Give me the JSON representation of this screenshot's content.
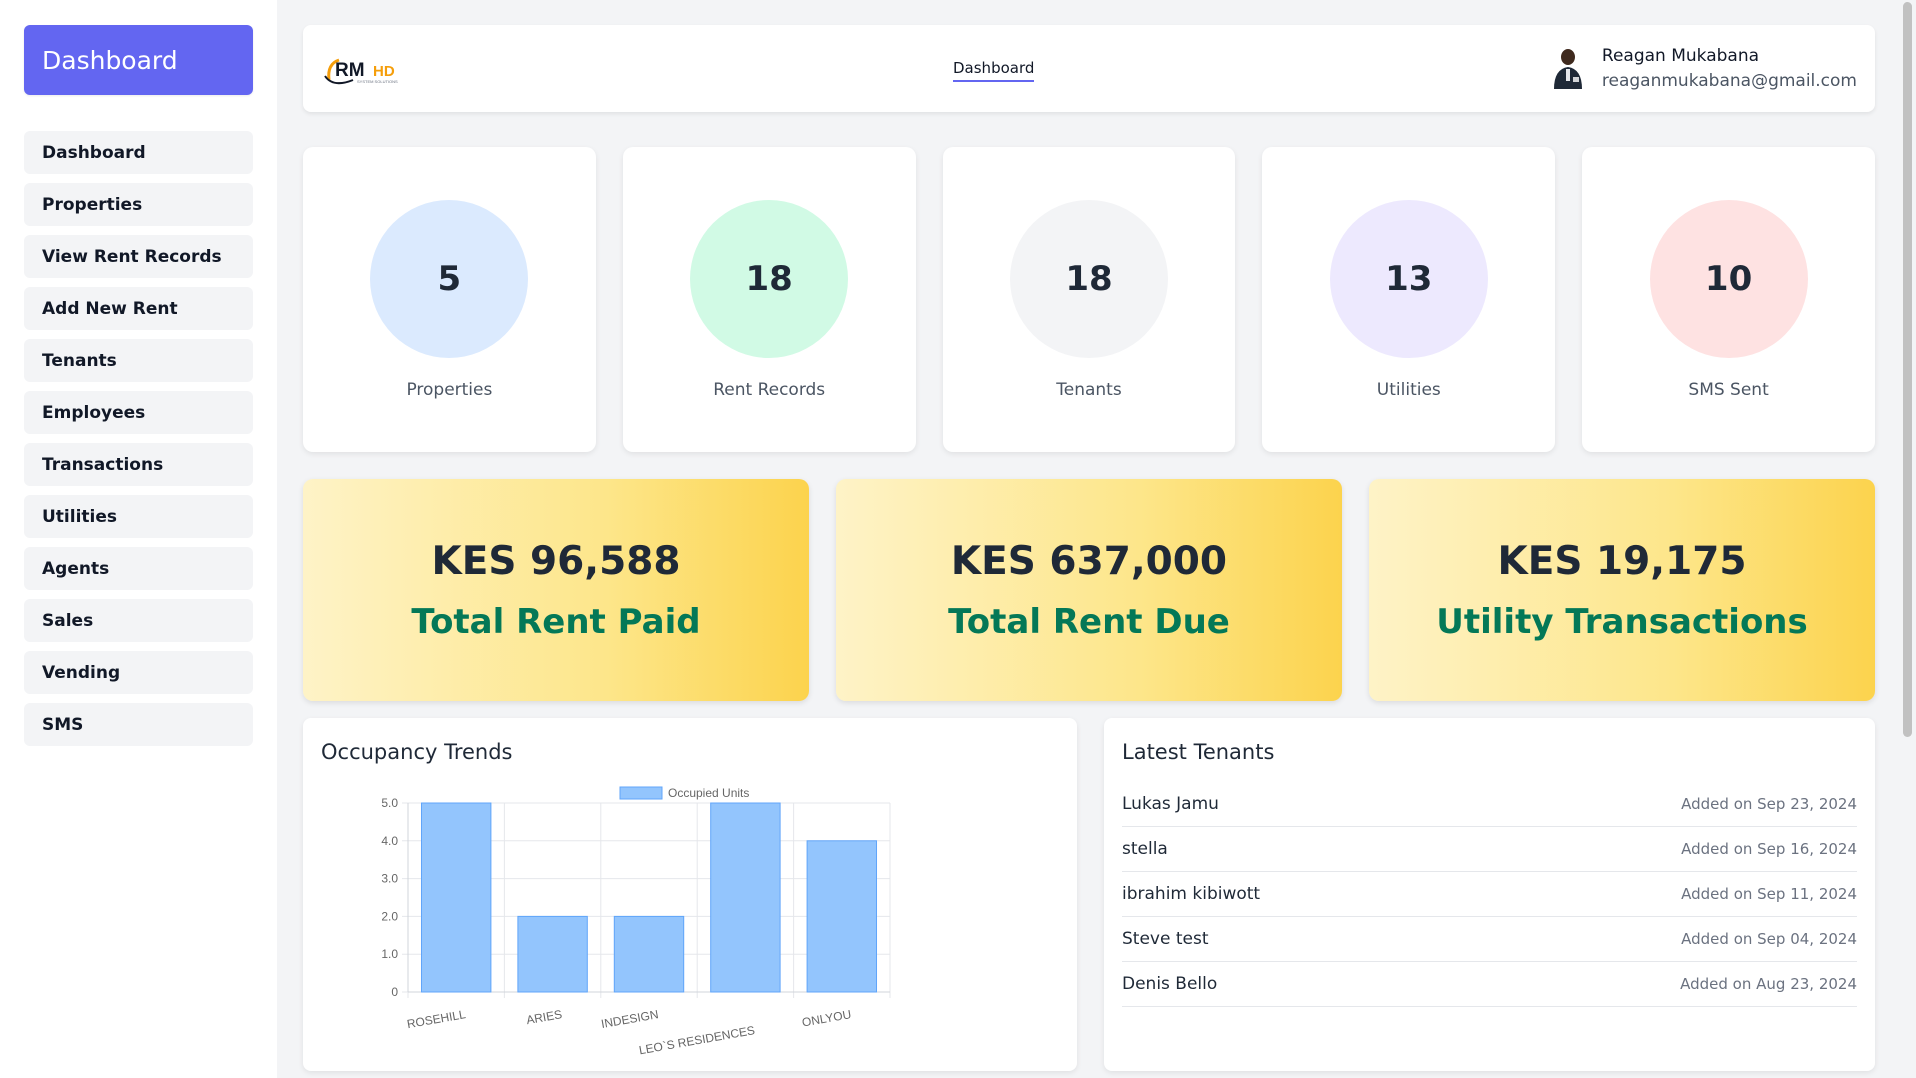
{
  "sidebar": {
    "title": "Dashboard",
    "items": [
      {
        "label": "Dashboard"
      },
      {
        "label": "Properties"
      },
      {
        "label": "View Rent Records"
      },
      {
        "label": "Add New Rent"
      },
      {
        "label": "Tenants"
      },
      {
        "label": "Employees"
      },
      {
        "label": "Transactions"
      },
      {
        "label": "Utilities"
      },
      {
        "label": "Agents"
      },
      {
        "label": "Sales"
      },
      {
        "label": "Vending"
      },
      {
        "label": "SMS"
      }
    ]
  },
  "header": {
    "logo_text": "RMHD",
    "logo_subtext": "SYSTEM SOLUTIONS",
    "nav_link": "Dashboard",
    "user": {
      "name": "Reagan Mukabana",
      "email": "reaganmukabana@gmail.com"
    }
  },
  "stats": [
    {
      "value": "5",
      "label": "Properties",
      "color": "#dbeafe"
    },
    {
      "value": "18",
      "label": "Rent Records",
      "color": "#d1fae5"
    },
    {
      "value": "18",
      "label": "Tenants",
      "color": "#f3f4f6"
    },
    {
      "value": "13",
      "label": "Utilities",
      "color": "#ede9fe"
    },
    {
      "value": "10",
      "label": "SMS Sent",
      "color": "#fee2e2"
    }
  ],
  "money": [
    {
      "amount": "KES 96,588",
      "label": "Total Rent Paid"
    },
    {
      "amount": "KES 637,000",
      "label": "Total Rent Due"
    },
    {
      "amount": "KES 19,175",
      "label": "Utility Transactions"
    }
  ],
  "occupancy": {
    "title": "Occupancy Trends"
  },
  "chart_data": {
    "type": "bar",
    "categories": [
      "ROSEHILL",
      "ARIES",
      "INDESIGN",
      "LEO`S RESIDENCES",
      "ONLYOU"
    ],
    "series": [
      {
        "name": "Occupied Units",
        "values": [
          5,
          2,
          2,
          5,
          4
        ]
      }
    ],
    "ylim": [
      0,
      5
    ],
    "yticks": [
      "0",
      "1.0",
      "2.0",
      "3.0",
      "4.0",
      "5.0"
    ],
    "legend": "top",
    "grid": true,
    "bar_color": "#93c5fd",
    "bar_border": "#60a5fa"
  },
  "tenants": {
    "title": "Latest Tenants",
    "items": [
      {
        "name": "Lukas Jamu",
        "date": "Added on Sep 23, 2024"
      },
      {
        "name": "stella",
        "date": "Added on Sep 16, 2024"
      },
      {
        "name": "ibrahim kibiwott",
        "date": "Added on Sep 11, 2024"
      },
      {
        "name": "Steve test",
        "date": "Added on Sep 04, 2024"
      },
      {
        "name": "Denis Bello",
        "date": "Added on Aug 23, 2024"
      }
    ]
  }
}
